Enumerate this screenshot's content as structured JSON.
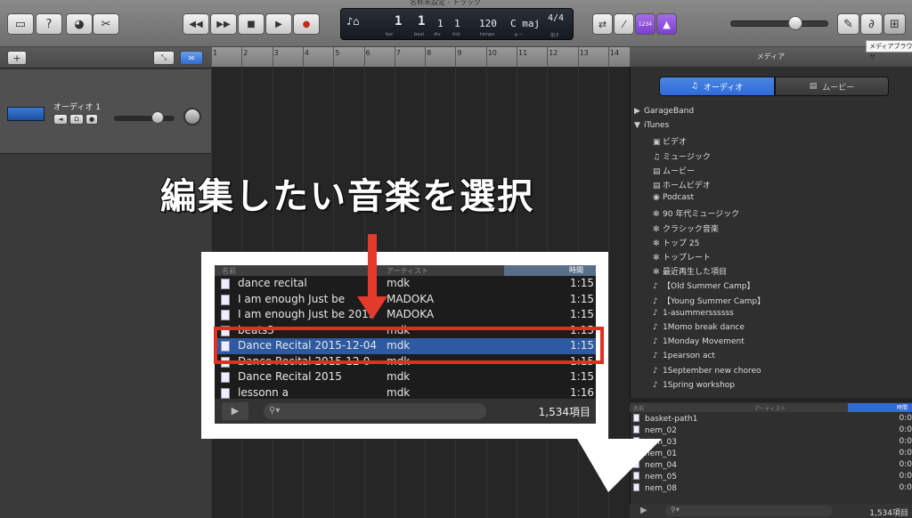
{
  "window": {
    "title": "名称未設定 - トラック"
  },
  "toolbar": {
    "buttons": [
      {
        "name": "library-button",
        "icon": "library-icon",
        "glyph": "▭"
      },
      {
        "name": "help-button",
        "icon": "help-icon",
        "glyph": "?"
      },
      {
        "name": "smart-controls-button",
        "icon": "smart-controls-icon",
        "glyph": "◕"
      },
      {
        "name": "editors-button",
        "icon": "scissors-icon",
        "glyph": "✂"
      }
    ],
    "transport": [
      {
        "name": "rewind-button",
        "icon": "rewind-icon",
        "glyph": "◀◀"
      },
      {
        "name": "fast-forward-button",
        "icon": "fast-forward-icon",
        "glyph": "▶▶"
      },
      {
        "name": "stop-button",
        "icon": "stop-icon",
        "glyph": "■"
      },
      {
        "name": "play-button",
        "icon": "play-icon",
        "glyph": "▶"
      },
      {
        "name": "record-button",
        "icon": "record-icon",
        "glyph": "●"
      }
    ],
    "right_buttons": [
      {
        "name": "cycle-button",
        "icon": "cycle-icon",
        "glyph": "⇄"
      },
      {
        "name": "tuner-button",
        "icon": "tuner-icon",
        "glyph": "⁄"
      },
      {
        "name": "count-in-button",
        "icon": "count-in-icon",
        "glyph": "1234"
      },
      {
        "name": "metronome-button",
        "icon": "metronome-icon",
        "glyph": "▲"
      }
    ],
    "far_right": [
      {
        "name": "notepad-button",
        "icon": "notepad-icon",
        "glyph": "✎"
      },
      {
        "name": "apple-loops-button",
        "icon": "loop-icon",
        "glyph": "∂"
      },
      {
        "name": "media-browser-button",
        "icon": "media-browser-icon",
        "glyph": "⊞"
      }
    ]
  },
  "lcd": {
    "bar": "1",
    "beat": "1",
    "div": "1",
    "tick": "1",
    "tempo": "120",
    "key": "C maj",
    "signature": "4/4",
    "labels": {
      "bar": "bar",
      "beat": "beat",
      "div": "div",
      "tick": "tick",
      "tempo": "tempo",
      "key": "キー",
      "signature": "拍子"
    }
  },
  "track": {
    "name": "オーディオ 1"
  },
  "ruler": {
    "bars": [
      "1",
      "2",
      "3",
      "4",
      "5",
      "6",
      "7",
      "8",
      "9",
      "10",
      "11",
      "12",
      "13",
      "14"
    ]
  },
  "overlay": {
    "caption": "編集したい音楽を選択",
    "zoom_header": {
      "name": "名前",
      "artist": "アーティスト",
      "time": "時間"
    },
    "zoom_rows": [
      {
        "name": "dance recital",
        "artist": "mdk",
        "time": "1:15"
      },
      {
        "name": "I am enough Just be",
        "artist": "MADOKA",
        "time": "1:15"
      },
      {
        "name": "I am enough Just be 2015",
        "artist": "MADOKA",
        "time": "1:15"
      },
      {
        "name": "beats3",
        "artist": "mdk",
        "time": "1:15"
      },
      {
        "name": "Dance Recital 2015-12-04",
        "artist": "mdk",
        "time": "1:15"
      },
      {
        "name": "Dance Recital 2015-12-0",
        "artist": "mdk",
        "time": "1:15"
      },
      {
        "name": "Dance Recital 2015",
        "artist": "mdk",
        "time": "1:15"
      },
      {
        "name": "lessonn a",
        "artist": "mdk",
        "time": "1:16"
      }
    ],
    "zoom_selected_index": 4,
    "zoom_count": "1,534項目"
  },
  "media": {
    "title": "メディア",
    "tooltip": "メディアブラウザ",
    "seg_audio": "オーディオ",
    "seg_movie": "ムービー",
    "tree": [
      {
        "label": "GarageBand",
        "level": 0,
        "glyph": "▶",
        "icon": "garageband-icon"
      },
      {
        "label": "iTunes",
        "level": 0,
        "glyph": "▼",
        "icon": "itunes-icon"
      },
      {
        "label": "ビデオ",
        "level": 1,
        "glyph": "▣",
        "icon": "video-icon"
      },
      {
        "label": "ミュージック",
        "level": 1,
        "glyph": "♫",
        "icon": "music-icon"
      },
      {
        "label": "ムービー",
        "level": 1,
        "glyph": "▤",
        "icon": "movie-icon"
      },
      {
        "label": "ホームビデオ",
        "level": 1,
        "glyph": "▤",
        "icon": "home-video-icon"
      },
      {
        "label": "Podcast",
        "level": 1,
        "glyph": "◉",
        "icon": "podcast-icon"
      },
      {
        "label": "90 年代ミュージック",
        "level": 1,
        "glyph": "✻",
        "icon": "smart-playlist-icon"
      },
      {
        "label": "クラシック音楽",
        "level": 1,
        "glyph": "✻",
        "icon": "smart-playlist-icon"
      },
      {
        "label": "トップ 25",
        "level": 1,
        "glyph": "✻",
        "icon": "smart-playlist-icon"
      },
      {
        "label": "トップレート",
        "level": 1,
        "glyph": "✻",
        "icon": "smart-playlist-icon"
      },
      {
        "label": "最近再生した項目",
        "level": 1,
        "glyph": "✻",
        "icon": "smart-playlist-icon"
      },
      {
        "label": "【Old Summer Camp】",
        "level": 1,
        "glyph": "♪",
        "icon": "playlist-icon"
      },
      {
        "label": "【Young Summer Camp】",
        "level": 1,
        "glyph": "♪",
        "icon": "playlist-icon"
      },
      {
        "label": "1-asummerssssss",
        "level": 1,
        "glyph": "♪",
        "icon": "playlist-icon"
      },
      {
        "label": "1Momo break dance",
        "level": 1,
        "glyph": "♪",
        "icon": "playlist-icon"
      },
      {
        "label": "1Monday Movement",
        "level": 1,
        "glyph": "♪",
        "icon": "playlist-icon"
      },
      {
        "label": "1pearson act",
        "level": 1,
        "glyph": "♪",
        "icon": "playlist-icon"
      },
      {
        "label": "1September new choreo",
        "level": 1,
        "glyph": "♪",
        "icon": "playlist-icon"
      },
      {
        "label": "1Spring workshop",
        "level": 1,
        "glyph": "♪",
        "icon": "playlist-icon"
      }
    ],
    "list_header": {
      "name": "名前",
      "artist": "アーティスト",
      "time": "時間"
    },
    "list": [
      {
        "name": "basket-path1",
        "time": "0:0"
      },
      {
        "name": "nem_02",
        "time": "0:0"
      },
      {
        "name": "nem_03",
        "time": "0:0"
      },
      {
        "name": "nem_01",
        "time": "0:0"
      },
      {
        "name": "nem_04",
        "time": "0:0"
      },
      {
        "name": "nem_05",
        "time": "0:0"
      },
      {
        "name": "nem_08",
        "time": "0:0"
      }
    ],
    "count": "1,534項目"
  },
  "colors": {
    "accent": "#2f6bd6",
    "highlight": "#e0301f",
    "selected_row": "#2d5aa0"
  }
}
